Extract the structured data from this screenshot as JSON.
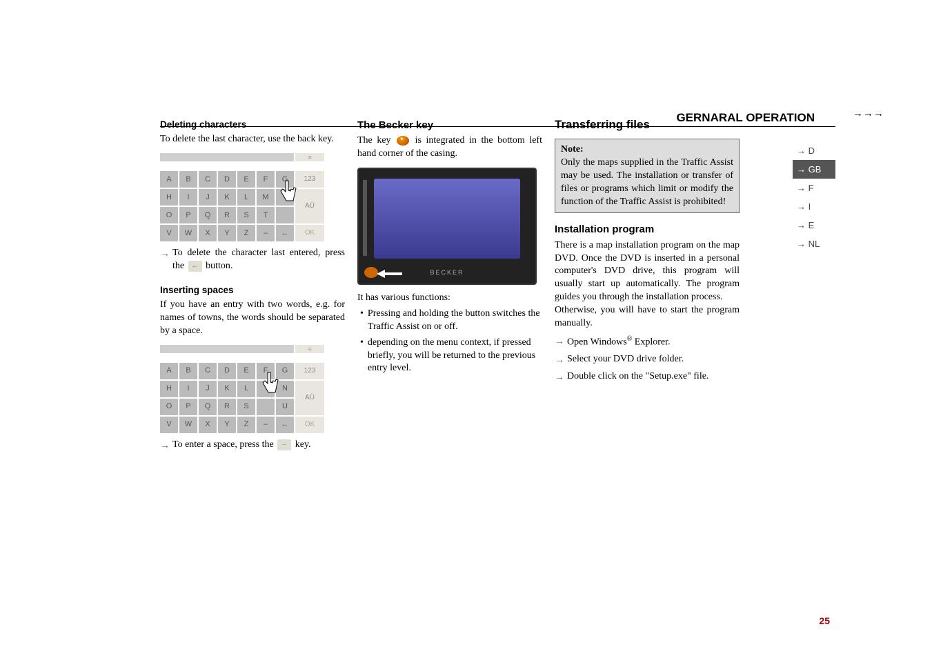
{
  "header": {
    "title": "GERNARAL OPERATION",
    "arrows": "→→→"
  },
  "sidebar": {
    "items": [
      {
        "label": "→ D"
      },
      {
        "label": "→ GB"
      },
      {
        "label": "→ F"
      },
      {
        "label": "→ I"
      },
      {
        "label": "→ E"
      },
      {
        "label": "→ NL"
      }
    ],
    "active_index": 1
  },
  "col1": {
    "h_del": "Deleting characters",
    "p_del": "To delete the last character, use the back key.",
    "step_del": "To delete the character last entered, press the ",
    "step_del2": " button.",
    "btn_back": "←",
    "h_ins": "Inserting spaces",
    "p_ins": "If you have an entry with two words, e.g. for names of towns, the words should be separated by a space.",
    "step_ins": "To enter a space, press the ",
    "step_ins2": " key.",
    "btn_space": "–",
    "kbd1": {
      "rows": [
        [
          "A",
          "B",
          "C",
          "D",
          "E",
          "F",
          "G"
        ],
        [
          "H",
          "I",
          "J",
          "K",
          "L",
          "M",
          " "
        ],
        [
          "O",
          "P",
          "Q",
          "R",
          "S",
          "T",
          " "
        ],
        [
          "V",
          "W",
          "X",
          "Y",
          "Z",
          "–",
          "←"
        ]
      ],
      "side": [
        "123",
        "AÜ",
        "OK"
      ]
    },
    "kbd2": {
      "rows": [
        [
          "A",
          "B",
          "C",
          "D",
          "E",
          "F",
          "G"
        ],
        [
          "H",
          "I",
          "J",
          "K",
          "L",
          " ",
          "N"
        ],
        [
          "O",
          "P",
          "Q",
          "R",
          "S",
          " ",
          "U"
        ],
        [
          "V",
          "W",
          "X",
          "Y",
          "Z",
          "–",
          "←"
        ]
      ],
      "side": [
        "123",
        "AÜ",
        "OK"
      ]
    }
  },
  "col2": {
    "h": "The Becker key",
    "p1a": "The key ",
    "p1b": " is integrated in the bottom left hand corner of the casing.",
    "logo": "BECKER",
    "p2": "It has various functions:",
    "b1": "Pressing and holding the button switches the Traffic Assist on or off.",
    "b2": "depending on the menu context, if pressed briefly, you will be returned to the previous entry level."
  },
  "col3": {
    "h1": "Transferring files",
    "note_label": "Note:",
    "note": "Only the maps supplied in the Traffic Assist may be used. The installation or transfer of files or programs which limit or modify the function of the Traffic Assist is prohibited!",
    "h2": "Installation program",
    "p_install": "There is a map installation program on the map DVD. Once the DVD is inserted in a personal computer's DVD drive, this program will usually start up automatically. The program guides you through the installation process.",
    "p_otherwise": "Otherwise, you will have to start the program manually.",
    "s1a": "Open Windows",
    "s1b": " Explorer.",
    "reg": "®",
    "s2": "Select your DVD drive folder.",
    "s3": "Double click on the \"Setup.exe\" file."
  },
  "page_number": "25"
}
